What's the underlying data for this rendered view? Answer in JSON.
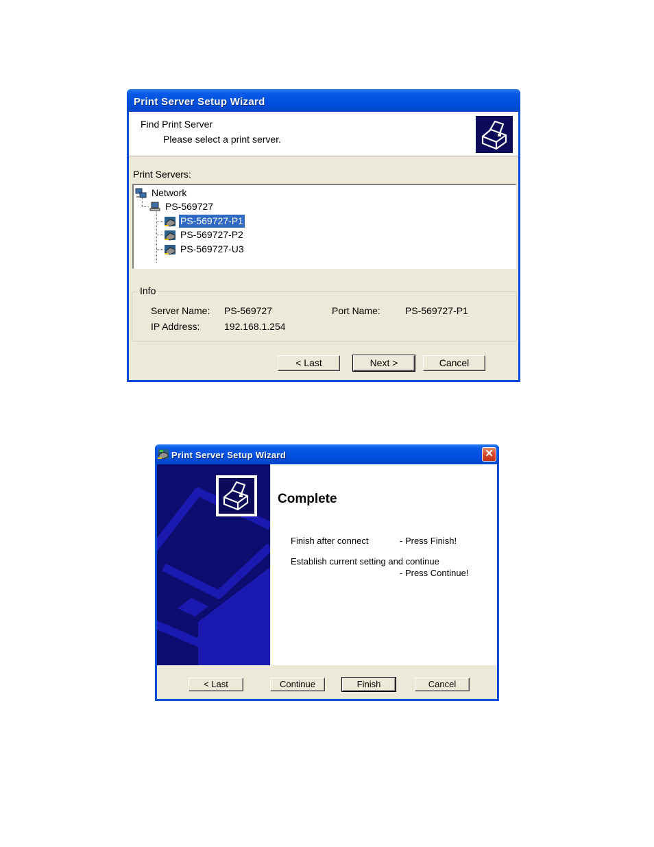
{
  "window1": {
    "title": "Print Server Setup Wizard",
    "header_title": "Find Print Server",
    "header_subtitle": "Please select a print server.",
    "header_icon": "printer-icon",
    "tree_label": "Print Servers:",
    "tree": {
      "root": {
        "label": "Network",
        "icon": "network-icon"
      },
      "server": {
        "label": "PS-569727",
        "icon": "computer-icon"
      },
      "ports": [
        {
          "label": "PS-569727-P1",
          "icon": "printer-port-icon",
          "selected": true
        },
        {
          "label": "PS-569727-P2",
          "icon": "printer-port-icon",
          "selected": false
        },
        {
          "label": "PS-569727-U3",
          "icon": "printer-port-icon",
          "selected": false
        }
      ]
    },
    "info": {
      "legend": "Info",
      "server_name_label": "Server Name:",
      "server_name_value": "PS-569727",
      "port_name_label": "Port Name:",
      "port_name_value": "PS-569727-P1",
      "ip_label": "IP Address:",
      "ip_value": "192.168.1.254"
    },
    "buttons": {
      "last": "< Last",
      "next": "Next >",
      "cancel": "Cancel"
    }
  },
  "window2": {
    "title": "Print Server Setup Wizard",
    "close_icon": "close-icon",
    "heading": "Complete",
    "line1_left": "Finish after connect",
    "line1_right": "- Press Finish!",
    "line2_left": "Establish current setting and continue",
    "line2_right": "- Press Continue!",
    "buttons": {
      "last": "< Last",
      "continue": "Continue",
      "finish": "Finish",
      "cancel": "Cancel"
    }
  },
  "colors": {
    "titlebar": "#0054e3",
    "dialog_bg": "#ece9d8",
    "selection": "#316ac5",
    "side_panel": "#0d0d70"
  }
}
